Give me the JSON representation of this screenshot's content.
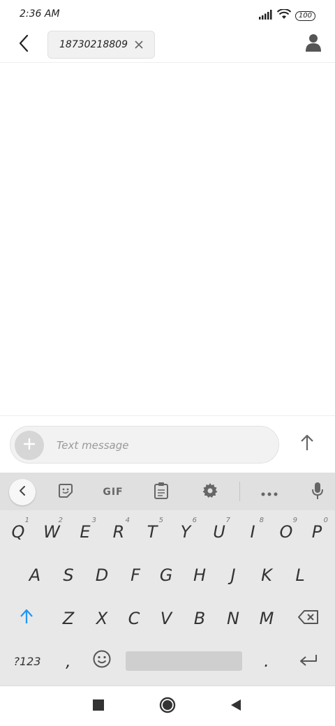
{
  "status_bar": {
    "time": "2:36 AM",
    "battery": "100",
    "icons": [
      "signal-icon",
      "wifi-icon",
      "battery-icon"
    ]
  },
  "header": {
    "back_icon": "back-arrow-icon",
    "recipient_chip": "18730218809",
    "chip_close_icon": "close-icon",
    "contact_icon": "person-icon"
  },
  "composer": {
    "attach_icon": "plus-icon",
    "placeholder": "Text message",
    "send_icon": "send-arrow-icon"
  },
  "keyboard": {
    "toolbar": {
      "back_icon": "chevron-left-icon",
      "sticker_icon": "sticker-icon",
      "gif_label": "GIF",
      "clipboard_icon": "clipboard-icon",
      "settings_icon": "gear-icon",
      "more_icon": "more-dots-icon",
      "mic_icon": "mic-icon"
    },
    "row1": [
      {
        "key": "Q",
        "hint": "1"
      },
      {
        "key": "W",
        "hint": "2"
      },
      {
        "key": "E",
        "hint": "3"
      },
      {
        "key": "R",
        "hint": "4"
      },
      {
        "key": "T",
        "hint": "5"
      },
      {
        "key": "Y",
        "hint": "6"
      },
      {
        "key": "U",
        "hint": "7"
      },
      {
        "key": "I",
        "hint": "8"
      },
      {
        "key": "O",
        "hint": "9"
      },
      {
        "key": "P",
        "hint": "0"
      }
    ],
    "row2": [
      "A",
      "S",
      "D",
      "F",
      "G",
      "H",
      "J",
      "K",
      "L"
    ],
    "row3": [
      "Z",
      "X",
      "C",
      "V",
      "B",
      "N",
      "M"
    ],
    "shift_icon": "shift-icon",
    "backspace_icon": "backspace-icon",
    "symbols_label": "?123",
    "comma_label": ",",
    "emoji_icon": "emoji-icon",
    "period_label": ".",
    "enter_icon": "enter-icon",
    "accent_color": "#2196f3"
  },
  "nav_bar": {
    "recents_icon": "square-icon",
    "home_icon": "circle-icon",
    "back_icon": "triangle-back-icon"
  }
}
